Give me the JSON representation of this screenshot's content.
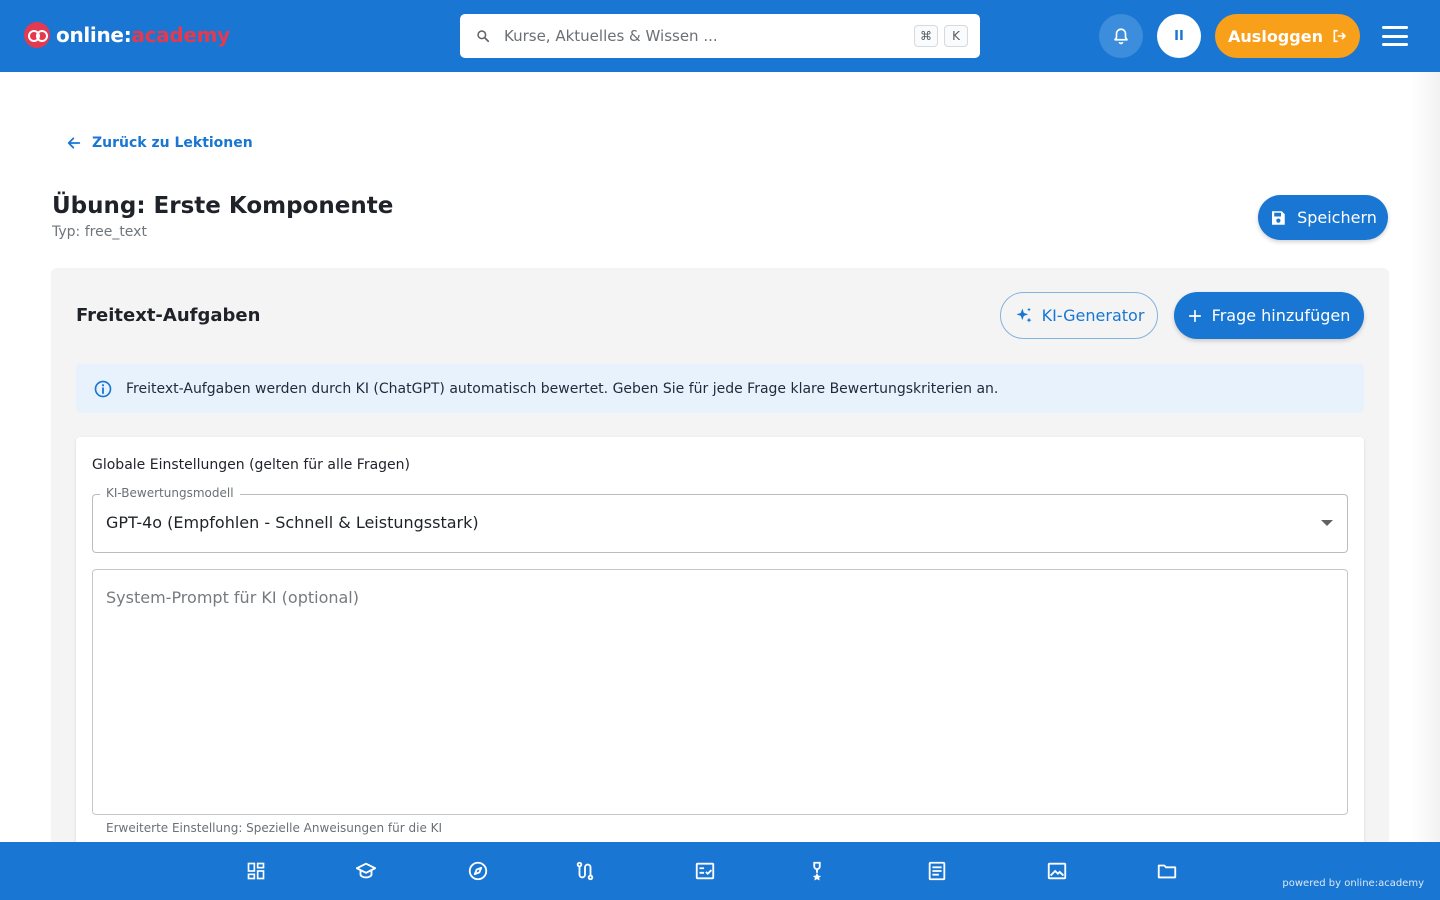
{
  "header": {
    "logo_prefix": "online:",
    "logo_suffix": "academy",
    "search_placeholder": "Kurse, Aktuelles & Wissen ...",
    "shortcut_key_1": "⌘",
    "shortcut_key_2": "K",
    "avatar_initials": "II",
    "logout_label": "Ausloggen"
  },
  "page": {
    "back_label": "Zurück zu Lektionen",
    "title": "Übung: Erste Komponente",
    "type_line": "Typ: free_text",
    "save_label": "Speichern"
  },
  "section": {
    "title": "Freitext-Aufgaben",
    "ki_generator_label": "KI-Generator",
    "add_question_label": "Frage hinzufügen",
    "info_text": "Freitext-Aufgaben werden durch KI (ChatGPT) automatisch bewertet. Geben Sie für jede Frage klare Bewertungskriterien an."
  },
  "settings": {
    "title": "Globale Einstellungen (gelten für alle Fragen)",
    "model_label": "KI-Bewertungsmodell",
    "model_value": "GPT-4o (Empfohlen - Schnell & Leistungsstark)",
    "prompt_placeholder": "System-Prompt für KI (optional)",
    "prompt_value": "",
    "prompt_helper": "Erweiterte Einstellung: Spezielle Anweisungen für die KI"
  },
  "bottom_nav": {
    "items": [
      {
        "icon": "dashboard-icon"
      },
      {
        "icon": "graduation-cap-icon"
      },
      {
        "icon": "compass-icon"
      },
      {
        "icon": "route-icon"
      },
      {
        "icon": "checklist-icon"
      },
      {
        "icon": "trophy-icon"
      },
      {
        "icon": "article-icon"
      },
      {
        "icon": "image-icon"
      },
      {
        "icon": "folder-icon"
      }
    ],
    "powered_by": "powered by online:academy"
  },
  "colors": {
    "primary": "#1976d2",
    "accent_orange": "#f9a01b",
    "brand_red": "#e53950",
    "info_bg": "#e8f2fd"
  }
}
